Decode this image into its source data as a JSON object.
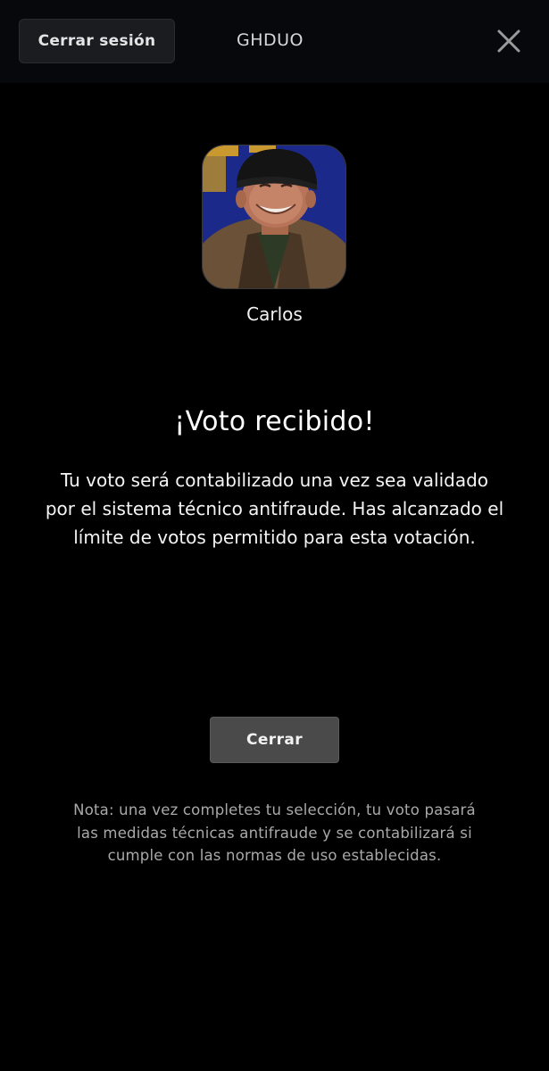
{
  "header": {
    "logout_label": "Cerrar sesión",
    "app_title": "GHDUO",
    "close_icon": "close-icon",
    "background_color": "#06080c"
  },
  "candidate": {
    "name": "Carlos",
    "avatar_icon": "candidate-photo"
  },
  "result": {
    "heading": "¡Voto recibido!",
    "message": "Tu voto será contabilizado una vez sea validado por el sistema técnico antifraude. Has alcanzado el límite de votos permitido para esta votación."
  },
  "actions": {
    "close_label": "Cerrar",
    "close_button_color": "#4a4a4a"
  },
  "footnote": {
    "text": "Nota: una vez completes tu selección, tu voto pasará las medidas técnicas antifraude y se contabilizará si cumple con las normas de uso establecidas."
  }
}
